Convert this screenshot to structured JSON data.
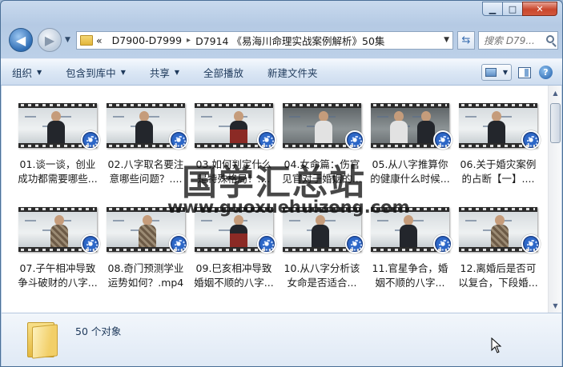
{
  "window": {
    "caption_buttons": {
      "minimize": "▁",
      "maximize": "□",
      "close": "✕"
    }
  },
  "nav": {
    "back_label": "◀",
    "forward_label": "▶",
    "history_arrow": "▼",
    "breadcrumb_chevron": "«",
    "breadcrumbs": [
      "D7900-D7999",
      "D7914 《易海川命理实战案例解析》50集"
    ],
    "crumb_sep": "▸",
    "address_dropdown": "▼",
    "refresh_label": "⇆",
    "search_placeholder": "搜索 D79..."
  },
  "toolbar": {
    "items": [
      {
        "label": "组织",
        "has_arrow": true
      },
      {
        "label": "包含到库中",
        "has_arrow": true
      },
      {
        "label": "共享",
        "has_arrow": true
      },
      {
        "label": "全部播放",
        "has_arrow": false
      },
      {
        "label": "新建文件夹",
        "has_arrow": false
      }
    ],
    "arrow": "▼",
    "help_label": "?"
  },
  "files": [
    {
      "name": "01.谈一谈，创业成功都需要哪些...",
      "thumb": "board-single"
    },
    {
      "name": "02.八字取名要注意哪些问题？....",
      "thumb": "board-single"
    },
    {
      "name": "03.如何判定什么是特殊格局！....",
      "thumb": "board-red"
    },
    {
      "name": "04.女命篇：伤官见官对于婚姻的...",
      "thumb": "standing-white"
    },
    {
      "name": "05.从八字推算你的健康什么时候...",
      "thumb": "two-people"
    },
    {
      "name": "06.关于婚灾案例的占断【一】....",
      "thumb": "board-single"
    },
    {
      "name": "07.子午相冲导致争斗破财的八字...",
      "thumb": "board-plaid"
    },
    {
      "name": "08.奇门预测学业运势如何？.mp4",
      "thumb": "board-plaid"
    },
    {
      "name": "09.巳亥相冲导致婚姻不顺的八字...",
      "thumb": "board-red"
    },
    {
      "name": "10.从八字分析该女命是否适合...",
      "thumb": "board-single"
    },
    {
      "name": "11.官星争合，婚姻不顺的八字...",
      "thumb": "board-single"
    },
    {
      "name": "12.离婚后是否可以复合，下段婚...",
      "thumb": "board-plaid"
    }
  ],
  "watermark": {
    "text_cn": "国学汇总站",
    "url": "www.guoxuehuizong.com"
  },
  "status": {
    "count_text": "50 个对象"
  },
  "scrollbar": {
    "up": "▲",
    "down": "▼"
  },
  "colors": {
    "accent": "#2f6db4",
    "toolbar_text": "#1e395b",
    "close_red": "#c9472c"
  }
}
